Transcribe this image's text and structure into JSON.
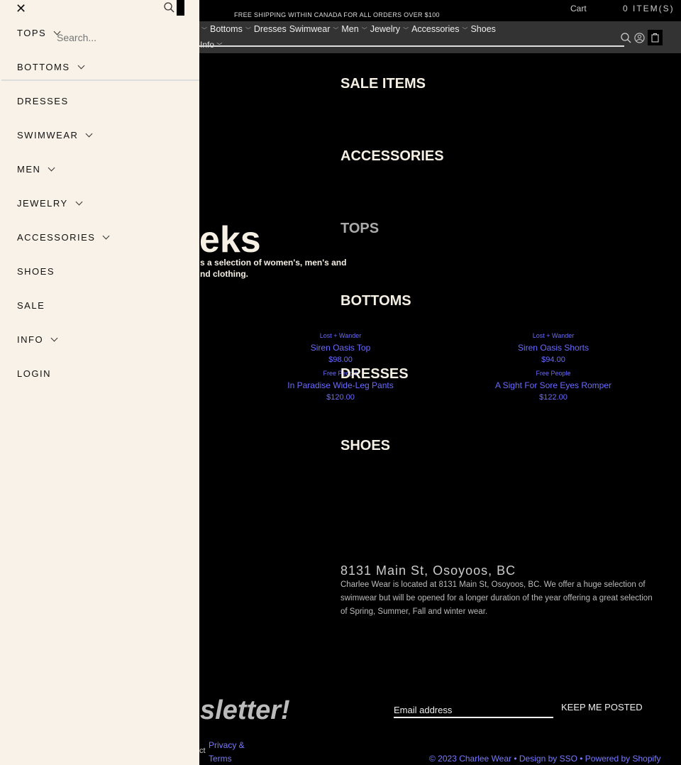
{
  "header": {
    "promo": "FREE SHIPPING WITHIN CANADA FOR ALL ORDERS OVER $100",
    "cart": "Cart",
    "items": "0 ITEM(S)",
    "nav": [
      "Bottoms",
      "Dresses",
      "Swimwear",
      "Men",
      "Jewelry",
      "Accessories",
      "Shoes"
    ],
    "info": "Info"
  },
  "categories": [
    "SALE ITEMS",
    "ACCESSORIES",
    "TOPS",
    "BOTTOMS",
    "DRESSES",
    "SHOES"
  ],
  "hero": {
    "title": "eeks",
    "line1": "s a selection of women's, men's and",
    "line2": "nd clothing."
  },
  "products": [
    {
      "vendor": "Lost + Wander",
      "name": "Siren Oasis Top",
      "price": "$98.00"
    },
    {
      "vendor": "Lost + Wander",
      "name": "Siren Oasis Shorts",
      "price": "$94.00"
    },
    {
      "vendor": "Free People",
      "name": "In Paradise Wide-Leg Pants",
      "price": "$120.00"
    },
    {
      "vendor": "Free People",
      "name": "A Sight For Sore Eyes Romper",
      "price": "$122.00"
    }
  ],
  "about": {
    "address": "8131 Main St, Osoyoos, BC",
    "text": "Charlee Wear is located at 8131 Main St, Osoyoos, BC. We offer a huge selection of swimwear but will be opened for a longer duration of the year offering a great selection of Spring, Summer, Fall and winter wear."
  },
  "newsletter": {
    "title": "sletter!",
    "email_placeholder": "Email address",
    "submit": "KEEP ME POSTED"
  },
  "footer": {
    "cut": "ct",
    "privacy1": "Privacy &",
    "privacy2": "Terms",
    "copyright": "© 2023 Charlee Wear • Design by SSO • Powered by Shopify"
  },
  "menu": {
    "search_placeholder": "Search...",
    "items": [
      {
        "label": "TOPS",
        "sub": true
      },
      {
        "label": "BOTTOMS",
        "sub": true
      },
      {
        "label": "DRESSES",
        "sub": false
      },
      {
        "label": "SWIMWEAR",
        "sub": true
      },
      {
        "label": "MEN",
        "sub": true
      },
      {
        "label": "JEWELRY",
        "sub": true
      },
      {
        "label": "ACCESSORIES",
        "sub": true
      },
      {
        "label": "SHOES",
        "sub": false
      },
      {
        "label": "SALE",
        "sub": false
      },
      {
        "label": "INFO",
        "sub": true
      },
      {
        "label": "LOGIN",
        "sub": false
      }
    ]
  }
}
